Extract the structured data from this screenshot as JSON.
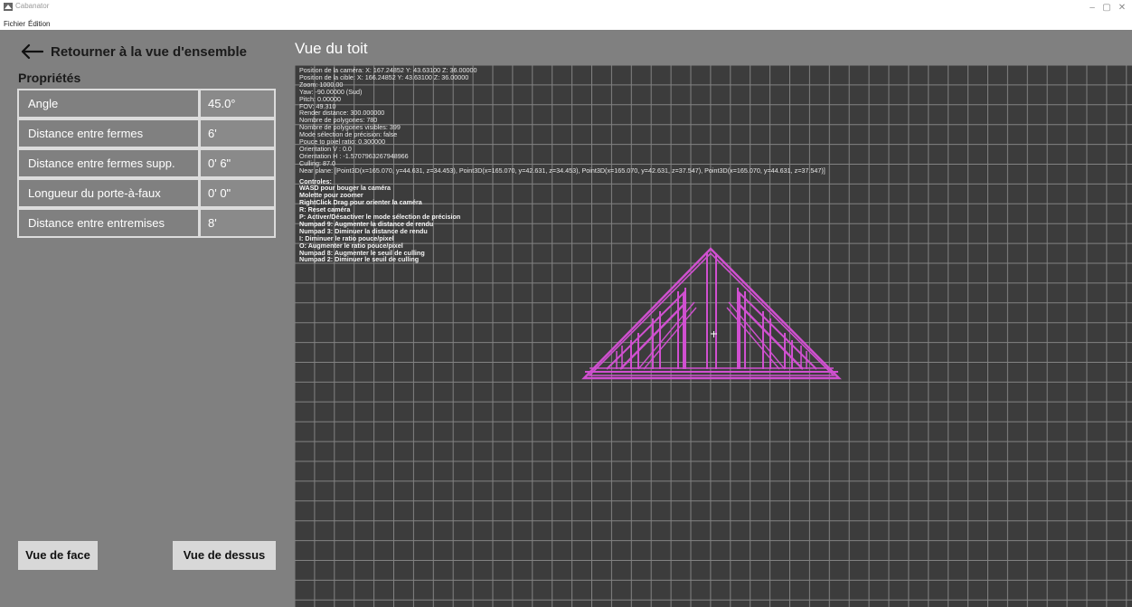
{
  "window": {
    "title": "Cabanator",
    "menu": [
      "Fichier",
      "Édition"
    ],
    "controls": {
      "minimize": "–",
      "maximize": "▢",
      "close": "✕"
    }
  },
  "sidebar": {
    "back_label": "Retourner à la vue d'ensemble",
    "properties_title": "Propriétés",
    "properties": [
      {
        "label": "Angle",
        "value": "45.0°"
      },
      {
        "label": "Distance entre fermes",
        "value": "6'"
      },
      {
        "label": "Distance entre fermes supp.",
        "value": "0' 6\""
      },
      {
        "label": "Longueur du porte-à-faux",
        "value": "0' 0\""
      },
      {
        "label": "Distance entre entremises",
        "value": "8'"
      }
    ],
    "buttons": {
      "front_view": "Vue de face",
      "top_view": "Vue de dessus"
    }
  },
  "main": {
    "view_title": "Vue du toit",
    "debug_lines": [
      "Position de la caméra: X: 167.24852 Y: 43.63100 Z: 36.00000",
      "Position de la cible: X: 166.24852 Y: 43.63100 Z: 36.00000",
      "Zoom: 1000.00",
      "Yaw: -90.00000 (Sud)",
      "Pitch: 0.00000",
      "FOV: 49.310",
      "Render distance: 300.000000",
      "Nombre de polygones: 780",
      "Nombre de polygones visibles: 399",
      "Mode sélection de précision: false",
      "Pouce to pixel ratio: 0.300000",
      "Orientation V : 0.0",
      "Orientation H : -1.5707963267948966",
      "Culling: 87.0",
      "Near plane: [Point3D(x=165.070, y=44.631, z=34.453), Point3D(x=165.070, y=42.631, z=34.453), Point3D(x=165.070, y=42.631, z=37.547), Point3D(x=165.070, y=44.631, z=37.547)]"
    ],
    "controls_lines": [
      "Controles:",
      "WASD pour bouger la caméra",
      "Molette pour zoomer",
      "RightClick Drag pour orienter la caméra",
      "R: Reset caméra",
      "P: Activer/Désactiver le mode sélection de précision",
      "Numpad 9: Augmenter la distance de rendu",
      "Numpad 3: Diminuer la distance de rendu",
      "I: Diminuer le ratio pouce/pixel",
      "O: Augmenter le ratio pouce/pixel",
      "Numpad 8: Augmenter le seuil de culling",
      "Numpad 2: Diminuer le seuil de culling"
    ],
    "colors": {
      "viewport_bg": "#3c3c3c",
      "grid": "#a0a0a0",
      "truss": "#cc44cc"
    }
  }
}
